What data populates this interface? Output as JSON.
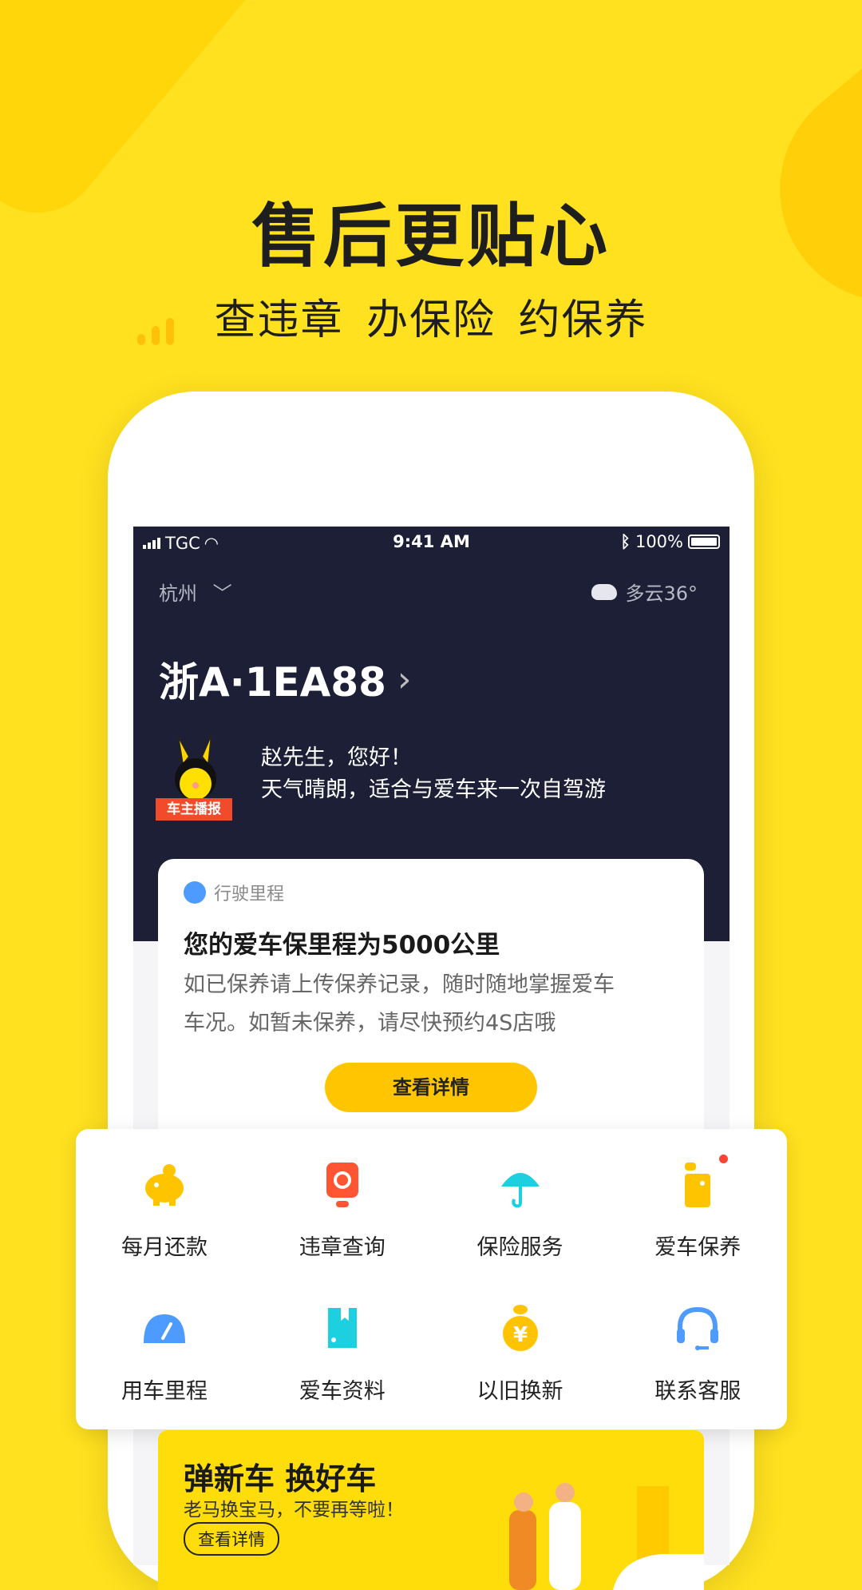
{
  "hero": {
    "title": "售后更贴心",
    "subtitle": "查违章 办保险 约保养"
  },
  "status_bar": {
    "carrier": "TGC",
    "time": "9:41 AM",
    "battery": "100%"
  },
  "header": {
    "city": "杭州",
    "weather": "多云36°"
  },
  "car": {
    "plate": "浙A·1EA88"
  },
  "broadcast": {
    "badge": "车主播报",
    "greeting": "赵先生，您好！",
    "message": "天气晴朗，适合与爱车来一次自驾游"
  },
  "mileage_card": {
    "tag": "行驶里程",
    "title": "您的爱车保里程为5000公里",
    "body_line1": "如已保养请上传保养记录，随时随地掌握爱车",
    "body_line2": "车况。如暂未保养，请尽快预约4S店哦",
    "button": "查看详情"
  },
  "services": [
    {
      "label": "每月还款",
      "icon": "piggy-bank-icon",
      "color": "#FFC400"
    },
    {
      "label": "违章查询",
      "icon": "camera-icon",
      "color": "#FF5533"
    },
    {
      "label": "保险服务",
      "icon": "umbrella-icon",
      "color": "#1CD0E0"
    },
    {
      "label": "爱车保养",
      "icon": "oil-can-icon",
      "color": "#FFC400",
      "badge_color": "#FF4433"
    },
    {
      "label": "用车里程",
      "icon": "speedometer-icon",
      "color": "#4D9BFF"
    },
    {
      "label": "爱车资料",
      "icon": "book-icon",
      "color": "#1CD0E0"
    },
    {
      "label": "以旧换新",
      "icon": "money-bag-icon",
      "color": "#FFC400"
    },
    {
      "label": "联系客服",
      "icon": "headset-icon",
      "color": "#4D9BFF"
    }
  ],
  "banner": {
    "title": "弹新车 换好车",
    "subtitle": "老马换宝马，不要再等啦！",
    "button": "查看详情"
  }
}
